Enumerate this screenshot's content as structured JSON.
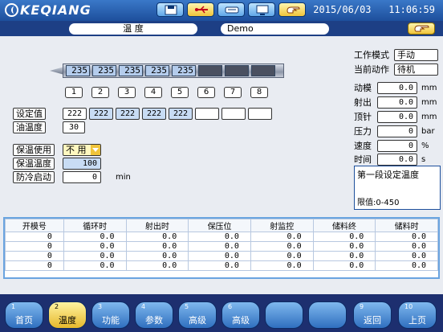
{
  "header": {
    "brand": "KEQIANG",
    "datetime": "2015/06/03   11:06:59",
    "toolbar_icons": [
      "save-icon",
      "usb-icon",
      "memory-card-icon",
      "screen-icon",
      "hand-icon"
    ]
  },
  "tabs": {
    "title": "温 度",
    "mold_name": "Demo",
    "hand_button_icon": "hand-icon"
  },
  "barrel": {
    "heater_values": [
      "235",
      "235",
      "235",
      "235",
      "235",
      "",
      "",
      ""
    ],
    "zone_numbers": [
      "1",
      "2",
      "3",
      "4",
      "5",
      "6",
      "7",
      "8"
    ]
  },
  "settings": {
    "set_label": "设定值",
    "set_values": [
      "222",
      "222",
      "222",
      "222",
      "222",
      "",
      "",
      ""
    ],
    "oil_label": "油温度",
    "oil_value": "30",
    "heat_preserve_label": "保温使用",
    "heat_preserve_value": "不 用",
    "heat_temp_label": "保温温度",
    "heat_temp_value": "100",
    "anti_cold_label": "防冷启动",
    "anti_cold_value": "0",
    "anti_cold_unit": "min"
  },
  "right_panel": {
    "mode_label": "工作模式",
    "mode_value": "手动",
    "action_label": "当前动作",
    "action_value": "待机",
    "rows": [
      {
        "label": "动模",
        "value": "0.0",
        "unit": "mm"
      },
      {
        "label": "射出",
        "value": "0.0",
        "unit": "mm"
      },
      {
        "label": "顶针",
        "value": "0.0",
        "unit": "mm"
      },
      {
        "label": "压力",
        "value": "0",
        "unit": "bar"
      },
      {
        "label": "速度",
        "value": "0",
        "unit": "%"
      },
      {
        "label": "时间",
        "value": "0.0",
        "unit": "s"
      }
    ],
    "hint_text": "第一段设定温度",
    "limit_text": "限值:0-450"
  },
  "table": {
    "headers": [
      "开模号",
      "循环时",
      "射出时",
      "保压位",
      "射监控",
      "储料终",
      "储料时"
    ],
    "rows": [
      [
        "0",
        "0.0",
        "0.0",
        "0.0",
        "0.0",
        "0.0",
        "0.0"
      ],
      [
        "0",
        "0.0",
        "0.0",
        "0.0",
        "0.0",
        "0.0",
        "0.0"
      ],
      [
        "0",
        "0.0",
        "0.0",
        "0.0",
        "0.0",
        "0.0",
        "0.0"
      ],
      [
        "0",
        "0.0",
        "0.0",
        "0.0",
        "0.0",
        "0.0",
        "0.0"
      ]
    ]
  },
  "footer": {
    "buttons": [
      {
        "num": "1",
        "label": "首页"
      },
      {
        "num": "2",
        "label": "温度"
      },
      {
        "num": "3",
        "label": "功能"
      },
      {
        "num": "4",
        "label": "参数"
      },
      {
        "num": "5",
        "label": "高级"
      },
      {
        "num": "6",
        "label": "高级"
      },
      {
        "num": "",
        "label": ""
      },
      {
        "num": "",
        "label": ""
      },
      {
        "num": "9",
        "label": "返回"
      },
      {
        "num": "10",
        "label": "上页"
      }
    ]
  }
}
